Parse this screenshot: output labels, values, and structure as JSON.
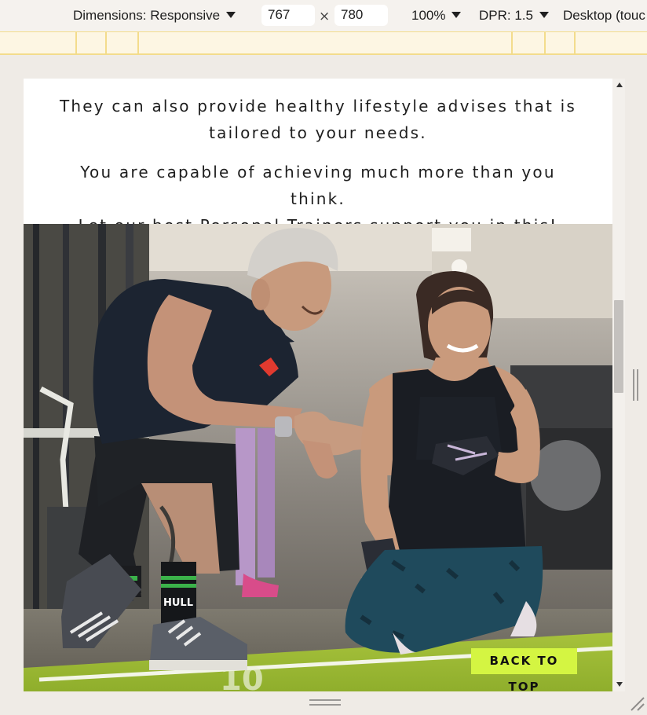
{
  "devtools": {
    "dimensions_label": "Dimensions: Responsive",
    "width_value": "767",
    "times_symbol": "×",
    "height_value": "780",
    "zoom": "100%",
    "dpr": "DPR: 1.5",
    "device_mode": "Desktop (touc"
  },
  "page": {
    "paragraph_1": "They can also provide healthy lifestyle advises that is tailored to your needs.",
    "paragraph_2_line_1": "You are capable of achieving much more than you think.",
    "paragraph_2_line_2": "Let our best Personal Trainers support you in this!",
    "back_to_top": "BACK TO TOP"
  },
  "colors": {
    "accent": "#d4f542",
    "toolbar_bg": "#f5f2ee",
    "media_query_bar": "#fdf6e3"
  }
}
